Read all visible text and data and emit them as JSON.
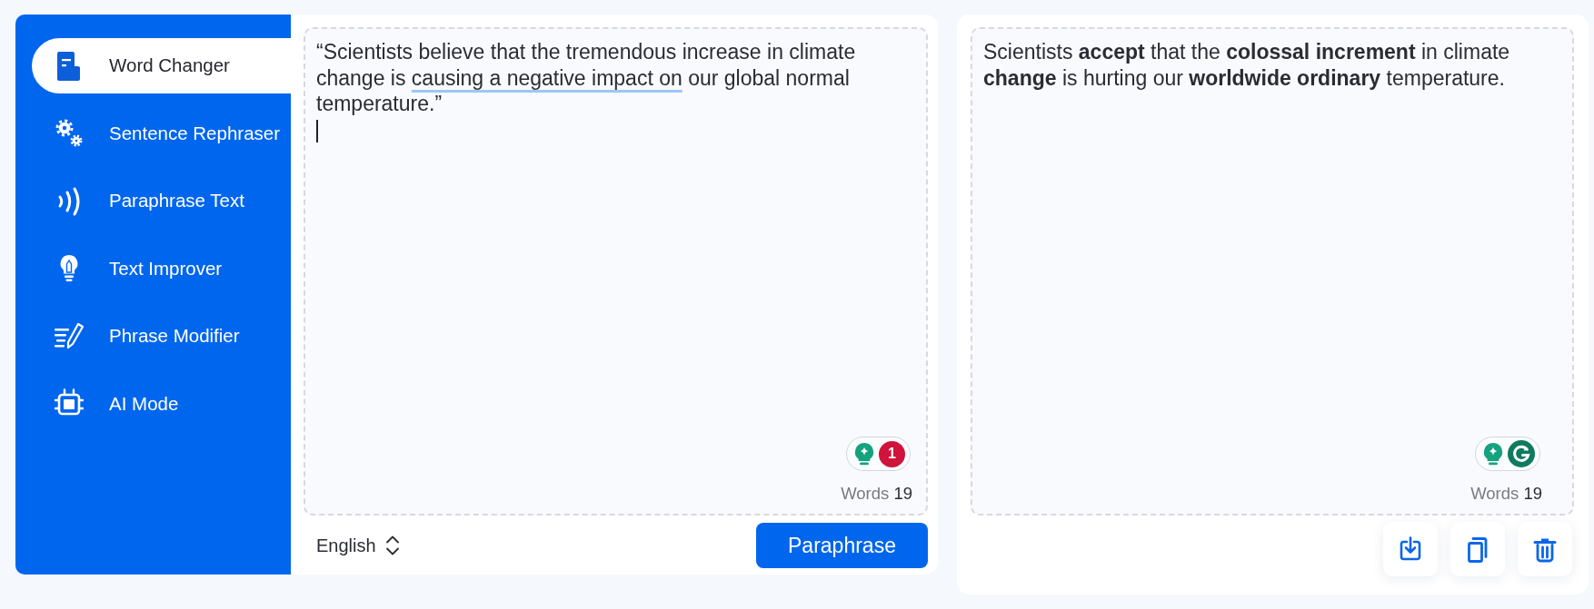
{
  "sidebar": {
    "items": [
      {
        "label": "Word Changer",
        "selected": true
      },
      {
        "label": "Sentence Rephraser",
        "selected": false
      },
      {
        "label": "Paraphrase Text",
        "selected": false
      },
      {
        "label": "Text Improver",
        "selected": false
      },
      {
        "label": "Phrase Modifier",
        "selected": false
      },
      {
        "label": "AI Mode",
        "selected": false
      }
    ]
  },
  "input": {
    "segments": [
      {
        "text": "“Scientists believe that the tremendous increase in climate change is ",
        "flagged": false
      },
      {
        "text": "causing a negative impact on",
        "flagged": true
      },
      {
        "text": " our global normal temperature.”",
        "flagged": false
      }
    ],
    "focused": true,
    "issue_count": "1",
    "word_count": {
      "label": "Words",
      "value": "19"
    }
  },
  "language": {
    "value": "English"
  },
  "paraphrase_button": {
    "label": "Paraphrase"
  },
  "output": {
    "text": "Scientists **accept** that the **colossal increment** in climate **change** is hurting our **worldwide ordinary** temperature.",
    "word_count": {
      "label": "Words",
      "value": "19"
    }
  }
}
